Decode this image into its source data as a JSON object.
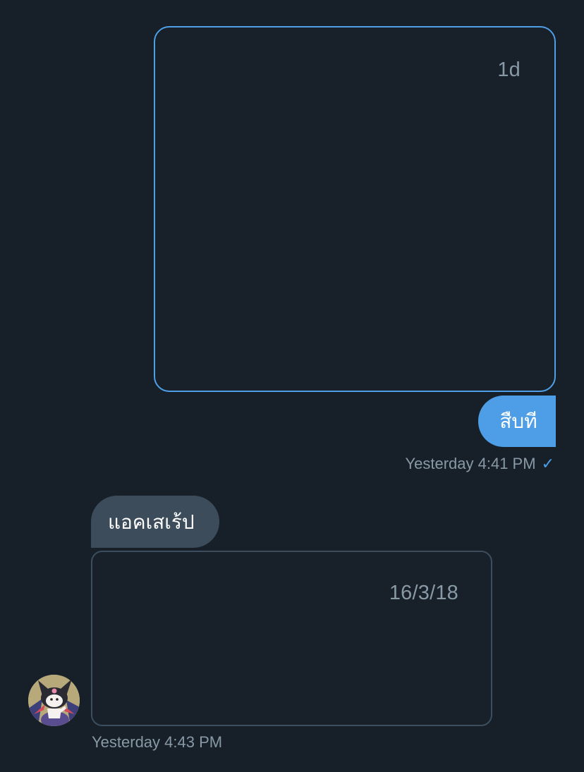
{
  "thread": {
    "sent_card": {
      "timestamp": "1d"
    },
    "sent_message": {
      "text": "สืบที",
      "meta_time": "Yesterday 4:41 PM",
      "status_icon": "checkmark-icon"
    },
    "received_message": {
      "text": "แอคเสเร้ป"
    },
    "received_card": {
      "timestamp": "16/3/18"
    },
    "received_meta": {
      "time": "Yesterday 4:43 PM",
      "avatar_icon": "kuromi-avatar"
    }
  },
  "colors": {
    "background": "#172029",
    "sent_bubble": "#4d9ee6",
    "received_bubble": "#3d4c5b",
    "meta_text": "#8899a6",
    "sent_card_border": "#4e9fe8",
    "received_card_border": "#3c4e5e"
  }
}
